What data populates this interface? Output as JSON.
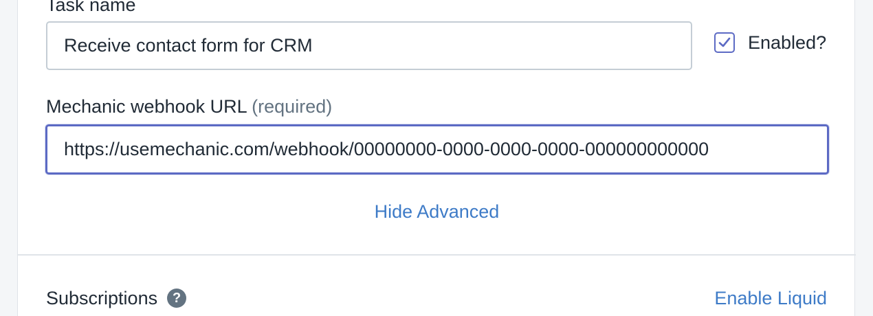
{
  "task_form": {
    "task_name_label": "Task name",
    "task_name_value": "Receive contact form for CRM",
    "enabled_label": "Enabled?",
    "enabled_checked": true,
    "webhook_label": "Mechanic webhook URL",
    "webhook_required": "(required)",
    "webhook_value": "https://usemechanic.com/webhook/00000000-0000-0000-0000-000000000000",
    "hide_advanced_label": "Hide Advanced"
  },
  "subscriptions": {
    "label": "Subscriptions",
    "help_icon": "question-circle-icon",
    "enable_liquid_label": "Enable Liquid"
  },
  "colors": {
    "accent": "#5c6ac4",
    "link": "#3e7bc7",
    "muted_text": "#637381",
    "border": "#c4cdd5"
  }
}
